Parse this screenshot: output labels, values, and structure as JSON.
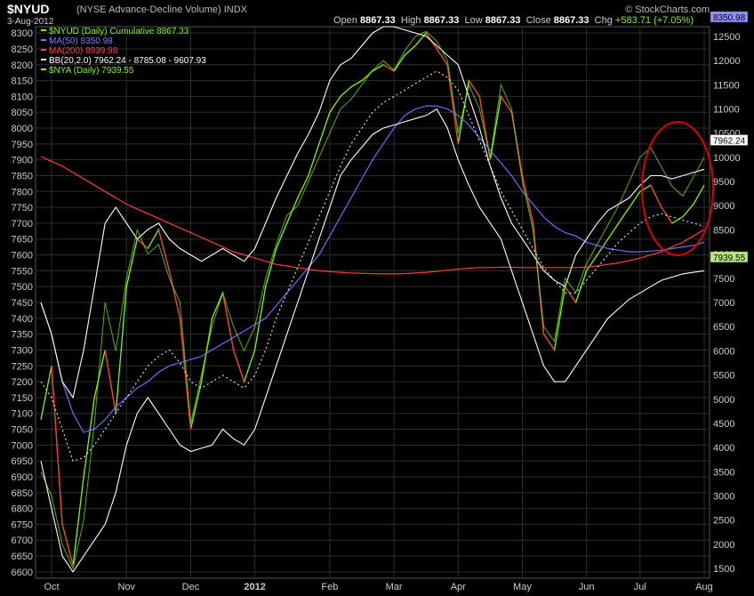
{
  "header": {
    "symbol": "$NYUD",
    "description": "(NYSE Advance-Decline Volume) INDX",
    "date": "3-Aug-2012",
    "open_label": "Open",
    "open": "8867.33",
    "high_label": "High",
    "high": "8867.33",
    "low_label": "Low",
    "low": "8867.33",
    "close_label": "Close",
    "close": "8867.33",
    "chg_label": "Chg",
    "chg": "+583.71 (+7.05%)",
    "brand": "© StockCharts.com"
  },
  "legend": [
    {
      "text": "$NYUD (Daily) Cumulative 8867.33",
      "color": "#7CFC00"
    },
    {
      "text": "MA(50) 8350.98",
      "color": "#7b7bff"
    },
    {
      "text": "MA(200) 8939.98",
      "color": "#ff4040"
    },
    {
      "text": "BB(20,2.0) 7962.24 - 8785.08 - 9607.93",
      "color": "#ffffff"
    },
    {
      "text": "$NYA (Daily) 7939.55",
      "color": "#7CFC00"
    }
  ],
  "colors": {
    "cumulative": "#7CFC00",
    "down": "#ff3030",
    "ma50": "#6b6bff",
    "ma200": "#ff3a3a",
    "bollinger": "#ffffff",
    "nya": "#7CFC00",
    "grid": "#2e2e2e",
    "circle": "#dd0000"
  },
  "chart_data": {
    "type": "line",
    "x": [
      "Sep-26",
      "Oct-01",
      "Oct-05",
      "Oct-10",
      "Oct-15",
      "Oct-20",
      "Oct-25",
      "Oct-31",
      "Nov-05",
      "Nov-10",
      "Nov-15",
      "Nov-20",
      "Nov-25",
      "Nov-30",
      "Dec-05",
      "Dec-10",
      "Dec-15",
      "Dec-20",
      "Dec-25",
      "Dec-31",
      "Jan-05",
      "Jan-10",
      "Jan-15",
      "Jan-20",
      "Jan-25",
      "Jan-31",
      "Feb-05",
      "Feb-10",
      "Feb-15",
      "Feb-20",
      "Feb-25",
      "Feb-29",
      "Mar-05",
      "Mar-10",
      "Mar-15",
      "Mar-20",
      "Mar-25",
      "Mar-31",
      "Apr-05",
      "Apr-10",
      "Apr-15",
      "Apr-20",
      "Apr-25",
      "Apr-30",
      "May-05",
      "May-10",
      "May-15",
      "May-20",
      "May-25",
      "May-31",
      "Jun-05",
      "Jun-10",
      "Jun-15",
      "Jun-20",
      "Jun-25",
      "Jun-30",
      "Jul-05",
      "Jul-10",
      "Jul-15",
      "Jul-20",
      "Jul-25",
      "Jul-31",
      "Aug-03"
    ],
    "x_ticks": [
      "Oct",
      "Nov",
      "Dec",
      "2012",
      "Feb",
      "Mar",
      "Apr",
      "May",
      "Jun",
      "Jul",
      "Aug"
    ],
    "yleft_ticks": [
      6600,
      6650,
      6700,
      6750,
      6800,
      6850,
      6900,
      6950,
      7000,
      7050,
      7100,
      7150,
      7200,
      7250,
      7300,
      7350,
      7400,
      7450,
      7500,
      7550,
      7600,
      7650,
      7700,
      7750,
      7800,
      7850,
      7900,
      7950,
      8000,
      8050,
      8100,
      8150,
      8200,
      8250,
      8300
    ],
    "yright_ticks": [
      1500,
      2000,
      2500,
      3000,
      3500,
      4000,
      4500,
      5000,
      5500,
      6000,
      6500,
      7000,
      7500,
      8000,
      8500,
      9000,
      9500,
      10000,
      10500,
      11000,
      11500,
      12000,
      12500
    ],
    "ylim_left": [
      6580,
      8320
    ],
    "ylim_right": [
      1300,
      12700
    ],
    "series": [
      {
        "name": "$NYUD (Daily) Cumulative",
        "axis": "left",
        "values": [
          7080,
          7250,
          6750,
          6620,
          6900,
          7150,
          7300,
          7100,
          7500,
          7650,
          7620,
          7680,
          7550,
          7400,
          7050,
          7200,
          7400,
          7480,
          7300,
          7200,
          7300,
          7500,
          7620,
          7700,
          7780,
          7850,
          7950,
          8050,
          8100,
          8130,
          8150,
          8180,
          8200,
          8180,
          8230,
          8260,
          8300,
          8250,
          8200,
          7950,
          8150,
          8100,
          7900,
          8100,
          8050,
          7850,
          7700,
          7350,
          7300,
          7500,
          7450,
          7550,
          7600,
          7650,
          7700,
          7750,
          7800,
          7820,
          7750,
          7700,
          7720,
          7760,
          7820
        ]
      },
      {
        "name": "MA(50)",
        "axis": "left",
        "values": [
          7450,
          7350,
          7200,
          7100,
          7040,
          7050,
          7080,
          7120,
          7150,
          7180,
          7200,
          7230,
          7250,
          7260,
          7270,
          7280,
          7300,
          7320,
          7340,
          7360,
          7380,
          7400,
          7440,
          7480,
          7520,
          7560,
          7600,
          7660,
          7720,
          7780,
          7840,
          7900,
          7950,
          8000,
          8040,
          8060,
          8070,
          8070,
          8060,
          8040,
          8010,
          7970,
          7930,
          7890,
          7850,
          7800,
          7760,
          7720,
          7690,
          7670,
          7660,
          7640,
          7630,
          7620,
          7615,
          7610,
          7610,
          7612,
          7615,
          7620,
          7625,
          7630,
          7640
        ]
      },
      {
        "name": "MA(200)",
        "axis": "left",
        "values": [
          7910,
          7895,
          7880,
          7860,
          7840,
          7820,
          7800,
          7780,
          7760,
          7745,
          7730,
          7715,
          7700,
          7685,
          7670,
          7655,
          7640,
          7625,
          7610,
          7600,
          7590,
          7580,
          7570,
          7565,
          7560,
          7555,
          7550,
          7547,
          7545,
          7543,
          7542,
          7541,
          7540,
          7540,
          7541,
          7543,
          7545,
          7548,
          7552,
          7555,
          7558,
          7560,
          7560,
          7561,
          7561,
          7560,
          7560,
          7560,
          7560,
          7560,
          7560,
          7562,
          7565,
          7570,
          7575,
          7582,
          7590,
          7600,
          7610,
          7625,
          7640,
          7660,
          7680
        ]
      },
      {
        "name": "BB upper",
        "axis": "left",
        "values": [
          7450,
          7350,
          7200,
          7150,
          7300,
          7500,
          7700,
          7750,
          7700,
          7650,
          7680,
          7700,
          7650,
          7620,
          7600,
          7580,
          7600,
          7620,
          7600,
          7580,
          7620,
          7700,
          7780,
          7850,
          7920,
          7980,
          8050,
          8150,
          8200,
          8220,
          8260,
          8300,
          8320,
          8320,
          8310,
          8300,
          8290,
          8260,
          8230,
          8200,
          8100,
          8000,
          7880,
          7780,
          7700,
          7650,
          7600,
          7550,
          7520,
          7500,
          7600,
          7650,
          7700,
          7740,
          7760,
          7780,
          7820,
          7850,
          7850,
          7840,
          7850,
          7860,
          7870
        ]
      },
      {
        "name": "BB middle",
        "axis": "left",
        "values": [
          7200,
          7150,
          7050,
          6950,
          6960,
          7000,
          7050,
          7100,
          7150,
          7200,
          7250,
          7280,
          7300,
          7260,
          7200,
          7180,
          7200,
          7220,
          7200,
          7180,
          7220,
          7300,
          7400,
          7480,
          7560,
          7640,
          7720,
          7800,
          7880,
          7950,
          8000,
          8050,
          8080,
          8100,
          8120,
          8140,
          8160,
          8180,
          8160,
          8120,
          8040,
          7960,
          7880,
          7800,
          7740,
          7680,
          7620,
          7560,
          7520,
          7480,
          7480,
          7520,
          7560,
          7600,
          7640,
          7670,
          7700,
          7720,
          7730,
          7720,
          7710,
          7700,
          7690
        ]
      },
      {
        "name": "BB lower",
        "axis": "left",
        "values": [
          6950,
          6800,
          6650,
          6600,
          6650,
          6700,
          6750,
          6850,
          7000,
          7100,
          7150,
          7100,
          7050,
          7000,
          6980,
          6990,
          7000,
          7050,
          7020,
          7000,
          7050,
          7150,
          7250,
          7350,
          7450,
          7550,
          7650,
          7750,
          7850,
          7900,
          7940,
          7980,
          8000,
          8010,
          8020,
          8030,
          8040,
          8060,
          8000,
          7900,
          7820,
          7750,
          7700,
          7650,
          7550,
          7450,
          7350,
          7250,
          7200,
          7200,
          7250,
          7300,
          7350,
          7400,
          7430,
          7460,
          7480,
          7500,
          7520,
          7530,
          7540,
          7545,
          7550
        ]
      },
      {
        "name": "$NYA (Daily)",
        "axis": "right",
        "values": [
          3500,
          3000,
          2000,
          1500,
          2500,
          4500,
          7000,
          6000,
          7500,
          8500,
          8000,
          8200,
          7500,
          7000,
          4500,
          5500,
          6500,
          7200,
          6500,
          6000,
          6500,
          7500,
          8200,
          8800,
          9000,
          9500,
          10000,
          10500,
          11000,
          11200,
          11500,
          11800,
          12000,
          11800,
          12200,
          12500,
          12600,
          12400,
          12000,
          10500,
          11500,
          11000,
          10000,
          11500,
          11000,
          9500,
          8500,
          6500,
          6200,
          7500,
          7200,
          7800,
          8200,
          8600,
          9000,
          9500,
          10000,
          10200,
          9800,
          9400,
          9200,
          9600,
          10000
        ]
      }
    ]
  }
}
